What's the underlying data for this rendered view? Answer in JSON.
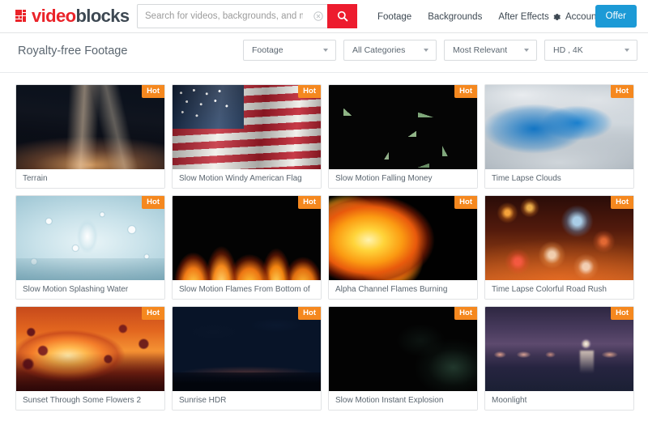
{
  "header": {
    "logo": {
      "part1": "video",
      "part2": "blocks",
      "mark": "logo-squares-icon"
    },
    "search": {
      "placeholder": "Search for videos, backgrounds, and more...",
      "value": "",
      "clear_icon": "clear-circle-icon",
      "search_icon": "search-icon"
    },
    "nav": [
      {
        "label": "Footage"
      },
      {
        "label": "Backgrounds"
      },
      {
        "label": "After Effects"
      }
    ],
    "account": {
      "label": "Account",
      "icon": "gear-icon"
    },
    "offer": {
      "label": "Offer",
      "color": "#1c9ad6"
    }
  },
  "filterbar": {
    "title": "Royalty-free Footage",
    "selects": [
      {
        "value": "Footage"
      },
      {
        "value": "All Categories"
      },
      {
        "value": "Most Relevant"
      },
      {
        "value": "HD , 4K"
      }
    ]
  },
  "badge": {
    "hot_label": "Hot",
    "hot_color": "#f5881f"
  },
  "grid": {
    "items": [
      {
        "title": "Terrain",
        "hot": "Hot",
        "art": "sc-terrain"
      },
      {
        "title": "Slow Motion Windy American Flag",
        "hot": "Hot",
        "art": "sc-flag"
      },
      {
        "title": "Slow Motion Falling Money",
        "hot": "Hot",
        "art": "sc-money"
      },
      {
        "title": "Time Lapse Clouds",
        "hot": "Hot",
        "art": "sc-clouds"
      },
      {
        "title": "Slow Motion Splashing Water",
        "hot": "Hot",
        "art": "sc-water"
      },
      {
        "title": "Slow Motion Flames From Bottom of",
        "hot": "Hot",
        "art": "sc-flames-bottom"
      },
      {
        "title": "Alpha Channel Flames Burning",
        "hot": "Hot",
        "art": "sc-alpha-flames"
      },
      {
        "title": "Time Lapse Colorful Road Rush",
        "hot": "Hot",
        "art": "sc-road"
      },
      {
        "title": "Sunset Through Some Flowers 2",
        "hot": "Hot",
        "art": "sc-sunset"
      },
      {
        "title": "Sunrise HDR",
        "hot": "Hot",
        "art": "sc-sunrise"
      },
      {
        "title": "Slow Motion Instant Explosion",
        "hot": "Hot",
        "art": "sc-explosion"
      },
      {
        "title": "Moonlight",
        "hot": "Hot",
        "art": "sc-moonlight"
      }
    ]
  }
}
